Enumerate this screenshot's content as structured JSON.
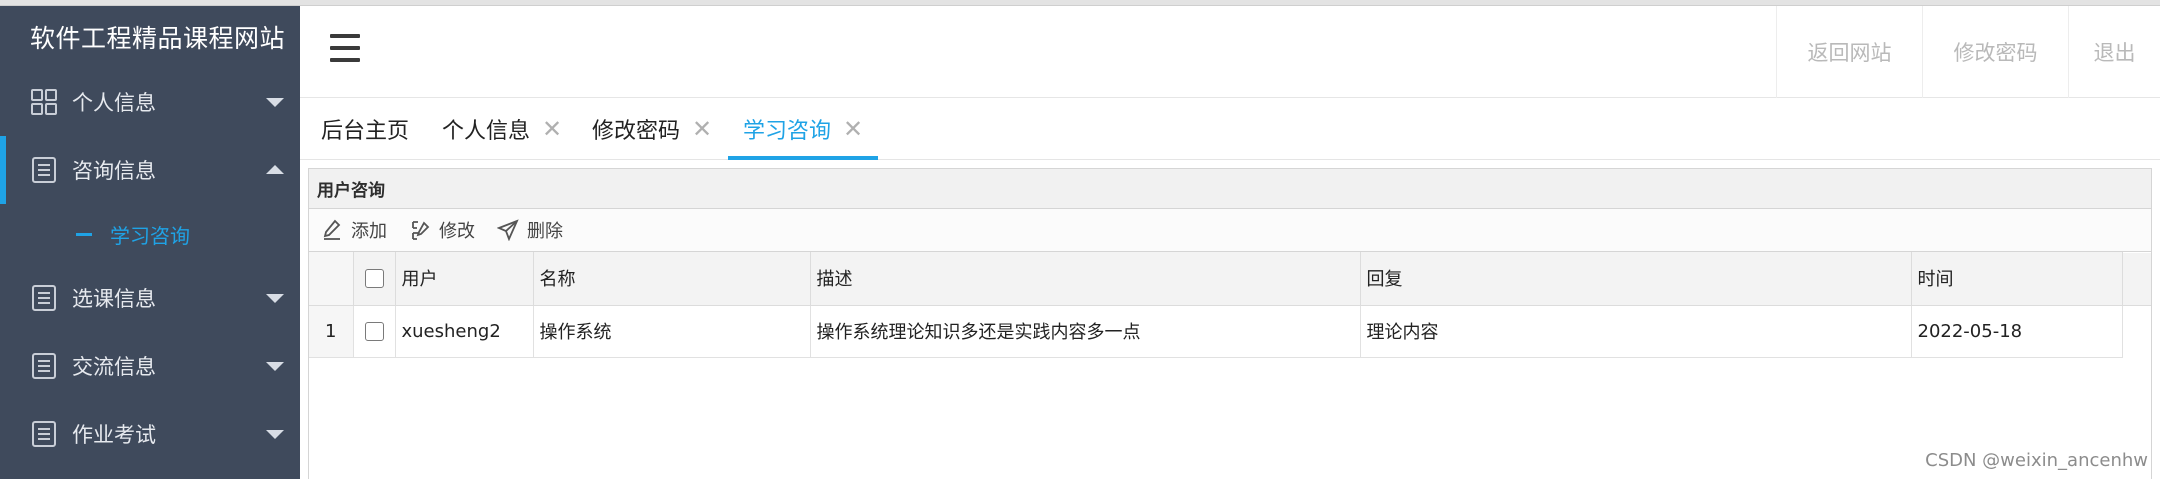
{
  "sidebar": {
    "brand": "软件工程精品课程网站",
    "items": [
      {
        "label": "个人信息",
        "icon": "grid-icon",
        "expanded": false
      },
      {
        "label": "咨询信息",
        "icon": "document-icon",
        "expanded": true
      },
      {
        "label": "选课信息",
        "icon": "document-icon",
        "expanded": false
      },
      {
        "label": "交流信息",
        "icon": "document-icon",
        "expanded": false
      },
      {
        "label": "作业考试",
        "icon": "document-icon",
        "expanded": false
      }
    ],
    "sub_items": [
      {
        "label": "学习咨询",
        "active": true
      }
    ]
  },
  "header": {
    "menu_icon": "hamburger-icon",
    "links": [
      "返回网站",
      "修改密码",
      "退出"
    ]
  },
  "tabs": [
    {
      "label": "后台主页",
      "closable": false,
      "active": false
    },
    {
      "label": "个人信息",
      "closable": true,
      "active": false
    },
    {
      "label": "修改密码",
      "closable": true,
      "active": false
    },
    {
      "label": "学习咨询",
      "closable": true,
      "active": true
    }
  ],
  "tab_close_glyph": "✕",
  "panel": {
    "title": "用户咨询",
    "toolbar": [
      {
        "label": "添加",
        "icon": "pencil-icon"
      },
      {
        "label": "修改",
        "icon": "edit-icon"
      },
      {
        "label": "删除",
        "icon": "send-icon"
      }
    ]
  },
  "table": {
    "columns": [
      "用户",
      "名称",
      "描述",
      "回复",
      "时间"
    ],
    "rows": [
      {
        "index": "1",
        "user": "xuesheng2",
        "name": "操作系统",
        "desc": "操作系统理论知识多还是实践内容多一点",
        "reply": "理论内容",
        "time": "2022-05-18"
      }
    ]
  },
  "watermark": "CSDN @weixin_ancenhw",
  "colors": {
    "sidebar_bg": "#3f4a5c",
    "accent": "#1fa3e6",
    "header_link": "#b9b9b9"
  }
}
